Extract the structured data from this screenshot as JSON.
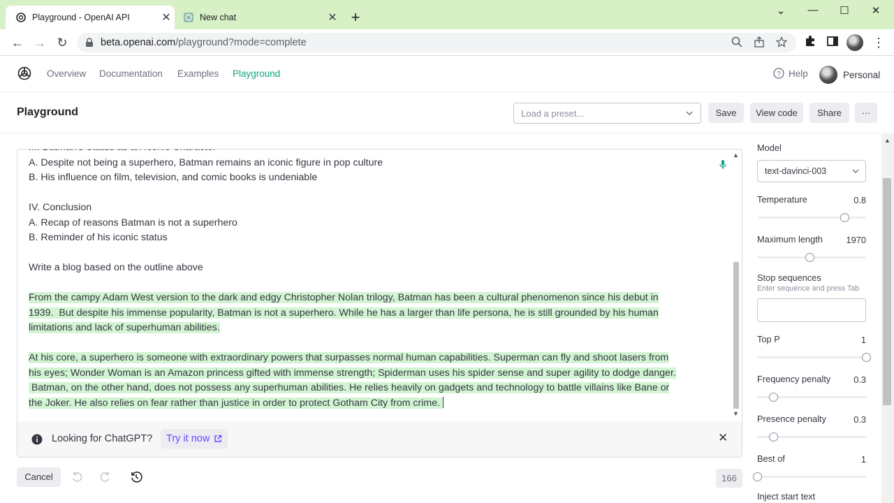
{
  "browser": {
    "tabs": [
      {
        "title": "Playground - OpenAI API",
        "active": true
      },
      {
        "title": "New chat",
        "active": false
      }
    ],
    "url_domain": "beta.openai.com",
    "url_path": "/playground?mode=complete"
  },
  "nav": {
    "links": [
      "Overview",
      "Documentation",
      "Examples",
      "Playground"
    ],
    "active": "Playground",
    "help": "Help",
    "account": "Personal"
  },
  "header": {
    "title": "Playground",
    "preset_placeholder": "Load a preset...",
    "save": "Save",
    "view_code": "View code",
    "share": "Share",
    "more": "···"
  },
  "editor": {
    "prompt_lines": [
      "III. Batman's Status as an Iconic Character",
      "A. Despite not being a superhero, Batman remains an iconic figure in pop culture",
      "B. His influence on film, television, and comic books is undeniable",
      "",
      "IV. Conclusion",
      "A. Recap of reasons Batman is not a superhero",
      "B. Reminder of his iconic status",
      "",
      "Write a blog based on the outline above",
      ""
    ],
    "generated_lines": [
      "From the campy Adam West version to the dark and edgy Christopher Nolan trilogy, Batman has been a cultural phenomenon since his debut in",
      "1939.  But despite his immense popularity, Batman is not a superhero. While he has a larger than life persona, he is still grounded by his human",
      "limitations and lack of superhuman abilities.",
      "",
      "At his core, a superhero is someone with extraordinary powers that surpasses normal human capabilities. Superman can fly and shoot lasers from",
      "his eyes; Wonder Woman is an Amazon princess gifted with immense strength; Spiderman uses his spider sense and super agility to dodge danger.",
      " Batman, on the other hand, does not possess any superhuman abilities. He relies heavily on gadgets and technology to battle villains like Bane or",
      "the Joker. He also relies on fear rather than justice in order to protect Gotham City from crime. "
    ]
  },
  "banner": {
    "message": "Looking for ChatGPT?",
    "link": "Try it now"
  },
  "footer": {
    "cancel": "Cancel",
    "token_count": "166"
  },
  "settings": {
    "model_label": "Model",
    "model_value": "text-davinci-003",
    "temperature": {
      "label": "Temperature",
      "value": "0.8",
      "fraction": 0.8
    },
    "max_length": {
      "label": "Maximum length",
      "value": "1970",
      "fraction": 0.48
    },
    "stop_sequences": {
      "label": "Stop sequences",
      "hint": "Enter sequence and press Tab"
    },
    "top_p": {
      "label": "Top P",
      "value": "1",
      "fraction": 1.0
    },
    "frequency_penalty": {
      "label": "Frequency penalty",
      "value": "0.3",
      "fraction": 0.15
    },
    "presence_penalty": {
      "label": "Presence penalty",
      "value": "0.3",
      "fraction": 0.15
    },
    "best_of": {
      "label": "Best of",
      "value": "1",
      "fraction": 0.0
    },
    "inject_start": {
      "label": "Inject start text"
    }
  },
  "colors": {
    "accent": "#10a37f",
    "highlight": "#d2f4d3",
    "tabbar": "#d7f0c5",
    "link": "#6b48ff"
  }
}
